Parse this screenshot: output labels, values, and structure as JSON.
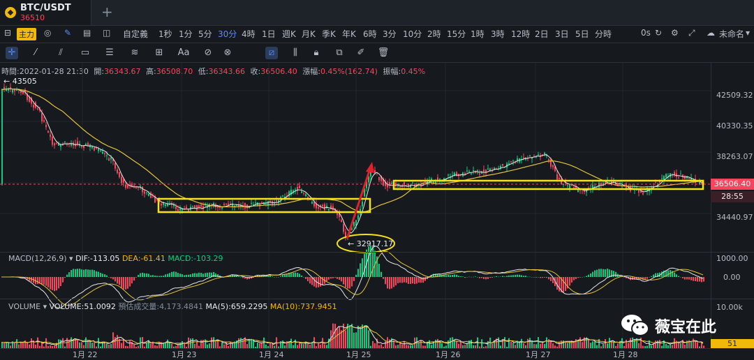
{
  "tab": {
    "pair": "BTC/USDT",
    "price": "36510",
    "new_tab": "+"
  },
  "toolbar": {
    "main_label": "主力",
    "custom": "自定義",
    "intervals": [
      "1秒",
      "1分",
      "5分",
      "30分",
      "4時",
      "1日",
      "週K",
      "月K",
      "季K",
      "年K",
      "6時",
      "3分",
      "10分",
      "2時",
      "15分",
      "1時",
      "3時",
      "12時",
      "2日",
      "3日",
      "5日",
      "分時"
    ],
    "active_interval": "30分",
    "zero_s": "0s",
    "layout_name": "未命名"
  },
  "ohlc": {
    "time_k": "時間:",
    "time": "2022-01-28 21:30",
    "open_k": "開:",
    "open": "36343.67",
    "high_k": "高:",
    "high": "36508.70",
    "low_k": "低:",
    "low": "36343.66",
    "close_k": "收:",
    "close": "36506.40",
    "change_k": "漲幅:",
    "change": "0.45%(162.74)",
    "amp_k": "振幅:",
    "amp": "0.45%"
  },
  "price_axis": [
    "42509.32",
    "40330.35",
    "38263.07",
    "34440.97"
  ],
  "current_price": "36506.40",
  "countdown": "28:55",
  "high_marker": "← 43505",
  "low_marker": "← 32917.17",
  "macd": {
    "title": "MACD(12,26,9)",
    "dif": "DIF:-113.05",
    "dea": "DEA:-61.41",
    "macd": "MACD:-103.29",
    "axis_top": "1000.00",
    "axis_zero": "0.00"
  },
  "volume": {
    "title": "VOLUME",
    "value": "VOLUME:51.0092",
    "est": "預估成交量:4,173.4841",
    "ma5": "MA(5):659.2295",
    "ma10": "MA(10):737.9451",
    "axis_top": "10.00k",
    "current": "51"
  },
  "x_axis": [
    "1月 22",
    "1月 23",
    "1月 24",
    "1月 25",
    "1月 26",
    "1月 27",
    "1月 28"
  ],
  "watermark": "薇宝在此",
  "colors": {
    "up": "#0ecb81",
    "down": "#f6465d",
    "accent": "#f0b90b",
    "blue": "#5b8cf8"
  }
}
